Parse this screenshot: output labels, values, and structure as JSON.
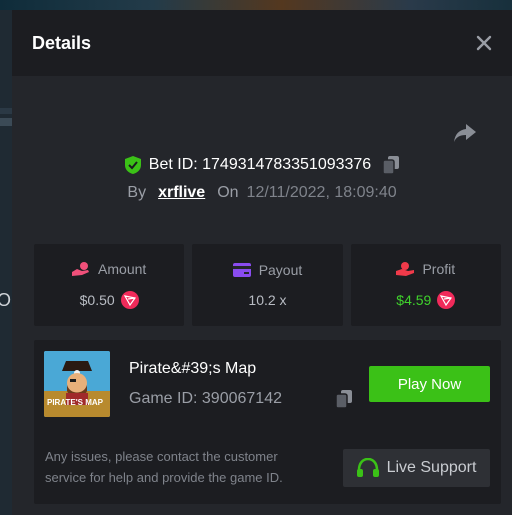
{
  "modal": {
    "title": "Details",
    "close_icon": "close-icon",
    "share_icon": "share-icon"
  },
  "bet": {
    "label": "Bet ID: 1749314783351093376",
    "verified_icon": "shield-check-icon",
    "copy_icon": "copy-icon",
    "by_label": "By",
    "user": "xrflive",
    "on_label": "On",
    "date": "12/11/2022, 18:09:40"
  },
  "stats": {
    "amount": {
      "label": "Amount",
      "value": "$0.50",
      "icon": "hand-coin-icon"
    },
    "payout": {
      "label": "Payout",
      "value": "10.2 x",
      "icon": "wallet-card-icon"
    },
    "profit": {
      "label": "Profit",
      "value": "$4.59",
      "icon": "hand-coin-icon"
    },
    "currency_icon": "tron-icon"
  },
  "game": {
    "name": "Pirate&#39;s Map",
    "thumb_text": "PIRATE'S MAP",
    "id_label": "Game ID: 390067142",
    "play_label": "Play Now",
    "issue_text": "Any issues, please contact the customer service for help and provide the game ID.",
    "support_label": "Live Support",
    "support_icon": "headset-icon"
  },
  "colors": {
    "accent_green": "#3bc117",
    "profit_green": "#3fd12c",
    "amount_icon": "#f0507a",
    "payout_icon": "#8a4cf0",
    "profit_icon": "#f03a4a",
    "tron_red": "#f02a5a"
  },
  "background": {
    "edge_char": "O"
  }
}
